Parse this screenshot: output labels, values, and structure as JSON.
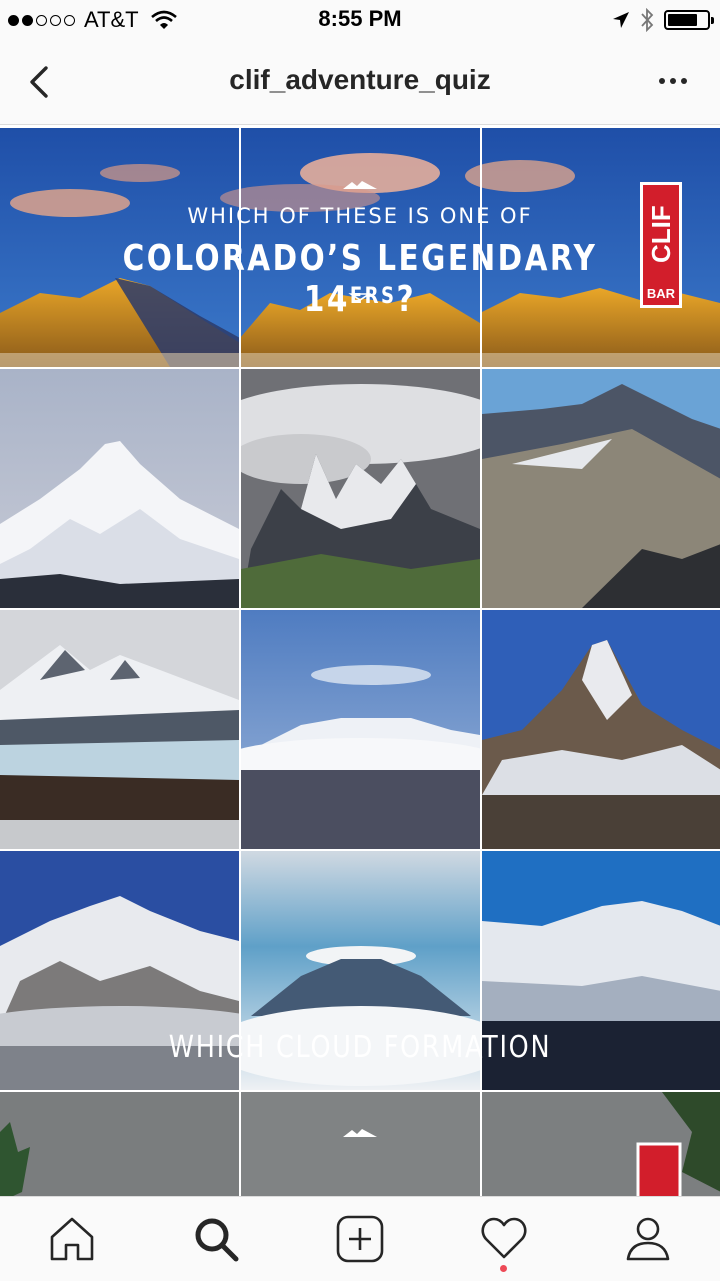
{
  "status_bar": {
    "carrier": "AT&T",
    "time": "8:55 PM",
    "signal_bars_filled": 2,
    "signal_bars_total": 5,
    "battery_level": 0.75
  },
  "header": {
    "title": "clif_adventure_quiz",
    "back_icon": "chevron-left-icon",
    "more_icon": "ellipsis-icon"
  },
  "banner_post": {
    "line1": "WHICH OF THESE IS ONE OF",
    "line2": "COLORADO’S LEGENDARY 14",
    "line2_sup": "ERS",
    "line2_end": "?",
    "logo_word": "CLIF",
    "logo_sub": "BAR"
  },
  "partial_post": {
    "line1": "WHICH CLOUD FORMATION"
  },
  "tab_bar": {
    "items": [
      "home-icon",
      "search-icon",
      "add-post-icon",
      "activity-heart-icon",
      "profile-icon"
    ],
    "active": "search-icon"
  },
  "colors": {
    "sky_blue": "#2f63b8",
    "clif_red": "#d21e2b",
    "notification": "#ed4956"
  }
}
